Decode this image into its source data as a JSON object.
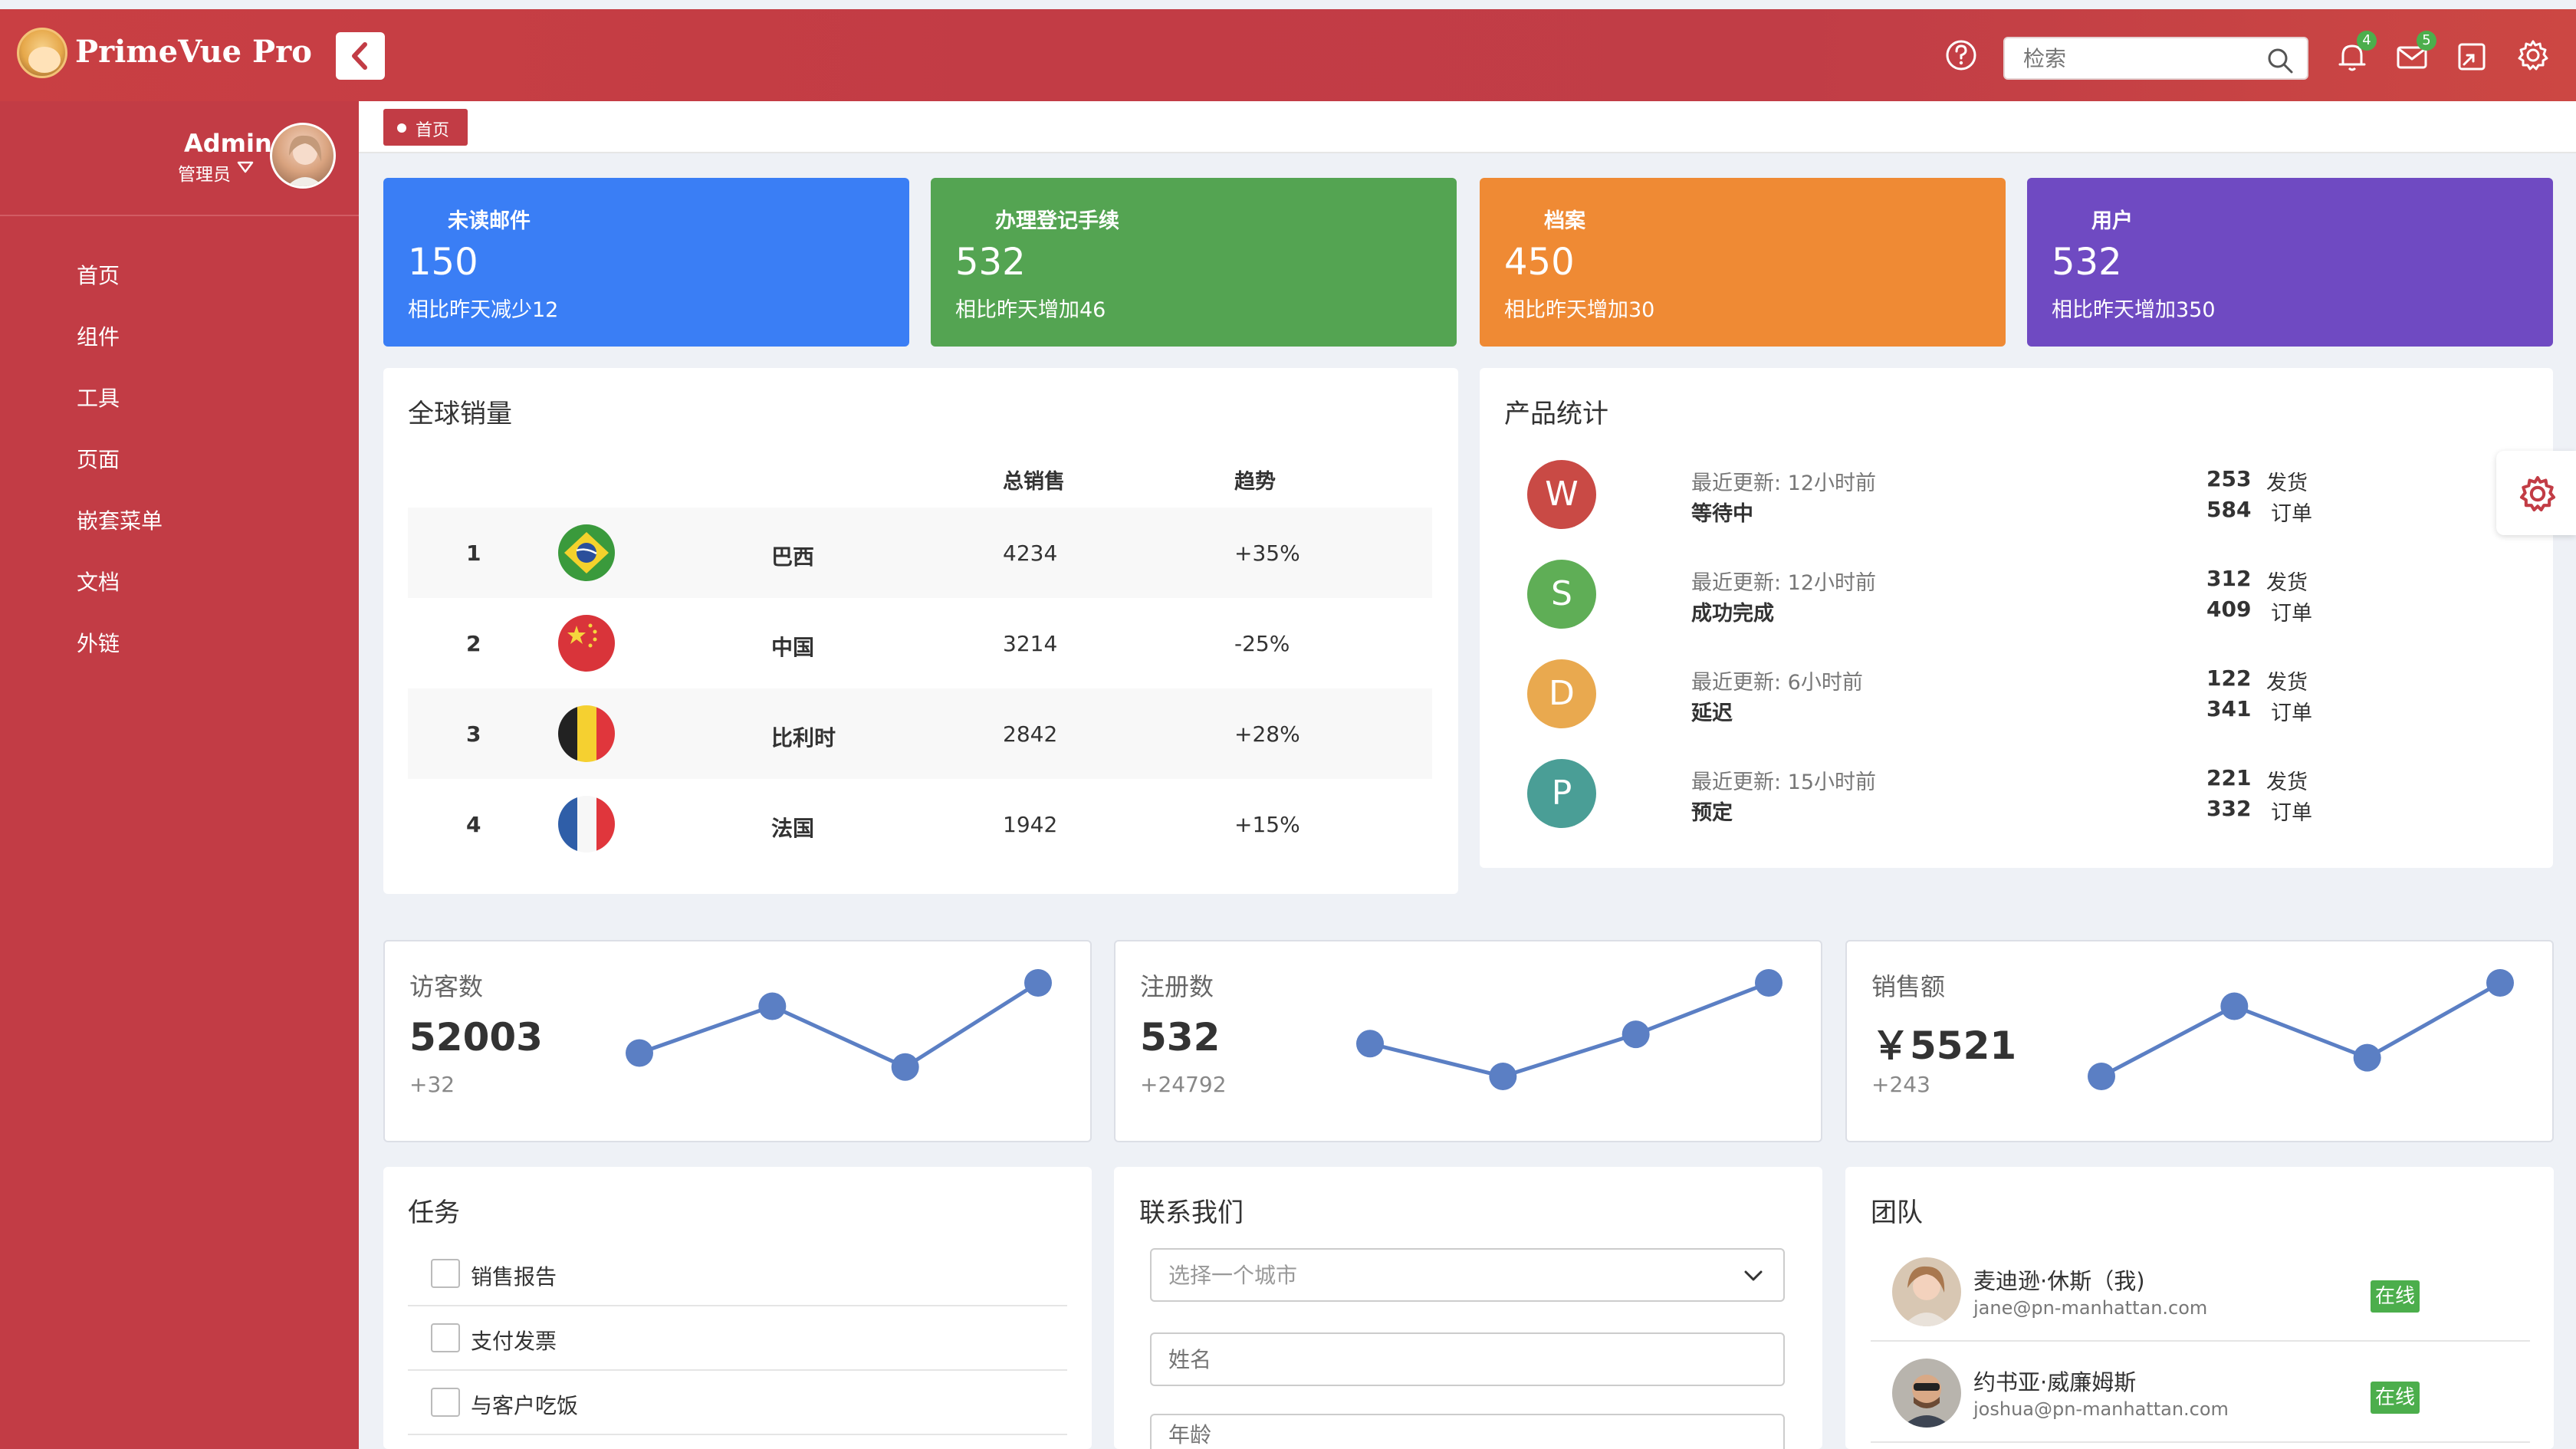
{
  "app": {
    "brand": "PrimeVue Pro"
  },
  "topbar": {
    "search_placeholder": "检索",
    "notifications_count": "4",
    "messages_count": "5"
  },
  "user": {
    "name": "Admin",
    "role": "管理员"
  },
  "sidebar": {
    "items": [
      {
        "label": "首页",
        "icon": "home-icon",
        "expandable": false
      },
      {
        "label": "组件",
        "icon": "sitemap-icon",
        "expandable": true
      },
      {
        "label": "工具",
        "icon": "globe-icon",
        "expandable": true
      },
      {
        "label": "页面",
        "icon": "clone-icon",
        "expandable": true
      },
      {
        "label": "嵌套菜单",
        "icon": "sort-amount-icon",
        "expandable": true
      },
      {
        "label": "文档",
        "icon": "question-icon",
        "expandable": false
      },
      {
        "label": "外链",
        "icon": "money-bill-icon",
        "expandable": false
      }
    ]
  },
  "breadcrumb": {
    "tab": "首页"
  },
  "stats": [
    {
      "title": "未读邮件",
      "value": "150",
      "sub": "相比昨天减少12",
      "color": "#3a7ef5",
      "icon": "inbox-icon"
    },
    {
      "title": "办理登记手续",
      "value": "532",
      "sub": "相比昨天增加46",
      "color": "#54a452",
      "icon": "map-marker-icon"
    },
    {
      "title": "档案",
      "value": "450",
      "sub": "相比昨天增加30",
      "color": "#ef8a34",
      "icon": "folder-icon"
    },
    {
      "title": "用户",
      "value": "532",
      "sub": "相比昨天增加350",
      "color": "#6f4ac2",
      "icon": "user-icon"
    }
  ],
  "sales": {
    "title": "全球销量",
    "headers": {
      "total": "总销售",
      "trend": "趋势"
    },
    "rows": [
      {
        "rank": "1",
        "country": "巴西",
        "total": "4234",
        "trend": "+35%",
        "flag": "brazil-flag"
      },
      {
        "rank": "2",
        "country": "中国",
        "total": "3214",
        "trend": "-25%",
        "flag": "china-flag"
      },
      {
        "rank": "3",
        "country": "比利时",
        "total": "2842",
        "trend": "+28%",
        "flag": "belgium-flag"
      },
      {
        "rank": "4",
        "country": "法国",
        "total": "1942",
        "trend": "+15%",
        "flag": "france-flag"
      }
    ]
  },
  "products": {
    "title": "产品统计",
    "ship_label": "发货",
    "order_label": "订单",
    "items": [
      {
        "letter": "W",
        "color": "#c94a45",
        "updated": "最近更新: 12小时前",
        "status": "等待中",
        "shipped": "253",
        "orders": "584"
      },
      {
        "letter": "S",
        "color": "#5fae56",
        "updated": "最近更新: 12小时前",
        "status": "成功完成",
        "shipped": "312",
        "orders": "409"
      },
      {
        "letter": "D",
        "color": "#e9a94f",
        "updated": "最近更新: 6小时前",
        "status": "延迟",
        "shipped": "122",
        "orders": "341"
      },
      {
        "letter": "P",
        "color": "#4a9e96",
        "updated": "最近更新: 15小时前",
        "status": "预定",
        "shipped": "221",
        "orders": "332"
      }
    ]
  },
  "minis": [
    {
      "label": "访客数",
      "value": "52003",
      "change": "+32"
    },
    {
      "label": "注册数",
      "value": "532",
      "change": "+24792"
    },
    {
      "label": "销售额",
      "value": "￥5521",
      "change": "+243"
    }
  ],
  "chart_data": [
    {
      "type": "line",
      "series": [
        {
          "values": [
            0.25,
            0.75,
            0.1,
            1.0
          ]
        }
      ],
      "color": "#5b7fc4"
    },
    {
      "type": "line",
      "series": [
        {
          "values": [
            0.35,
            0.0,
            0.45,
            1.0
          ]
        }
      ],
      "color": "#5b7fc4"
    },
    {
      "type": "line",
      "series": [
        {
          "values": [
            0.0,
            0.75,
            0.2,
            1.0
          ]
        }
      ],
      "color": "#5b7fc4"
    }
  ],
  "tasks": {
    "title": "任务",
    "items": [
      {
        "label": "销售报告",
        "icon": "briefcase-icon"
      },
      {
        "label": "支付发票",
        "icon": "file-icon"
      },
      {
        "label": "与客户吃饭",
        "icon": "comments-icon"
      }
    ]
  },
  "contact": {
    "title": "联系我们",
    "city_placeholder": "选择一个城市",
    "name_placeholder": "姓名",
    "age_placeholder": "年龄"
  },
  "team": {
    "title": "团队",
    "online_label": "在线",
    "members": [
      {
        "name": "麦迪逊·休斯（我)",
        "email": "jane@pn-manhattan.com"
      },
      {
        "name": "约书亚·威廉姆斯",
        "email": "joshua@pn-manhattan.com"
      }
    ]
  }
}
